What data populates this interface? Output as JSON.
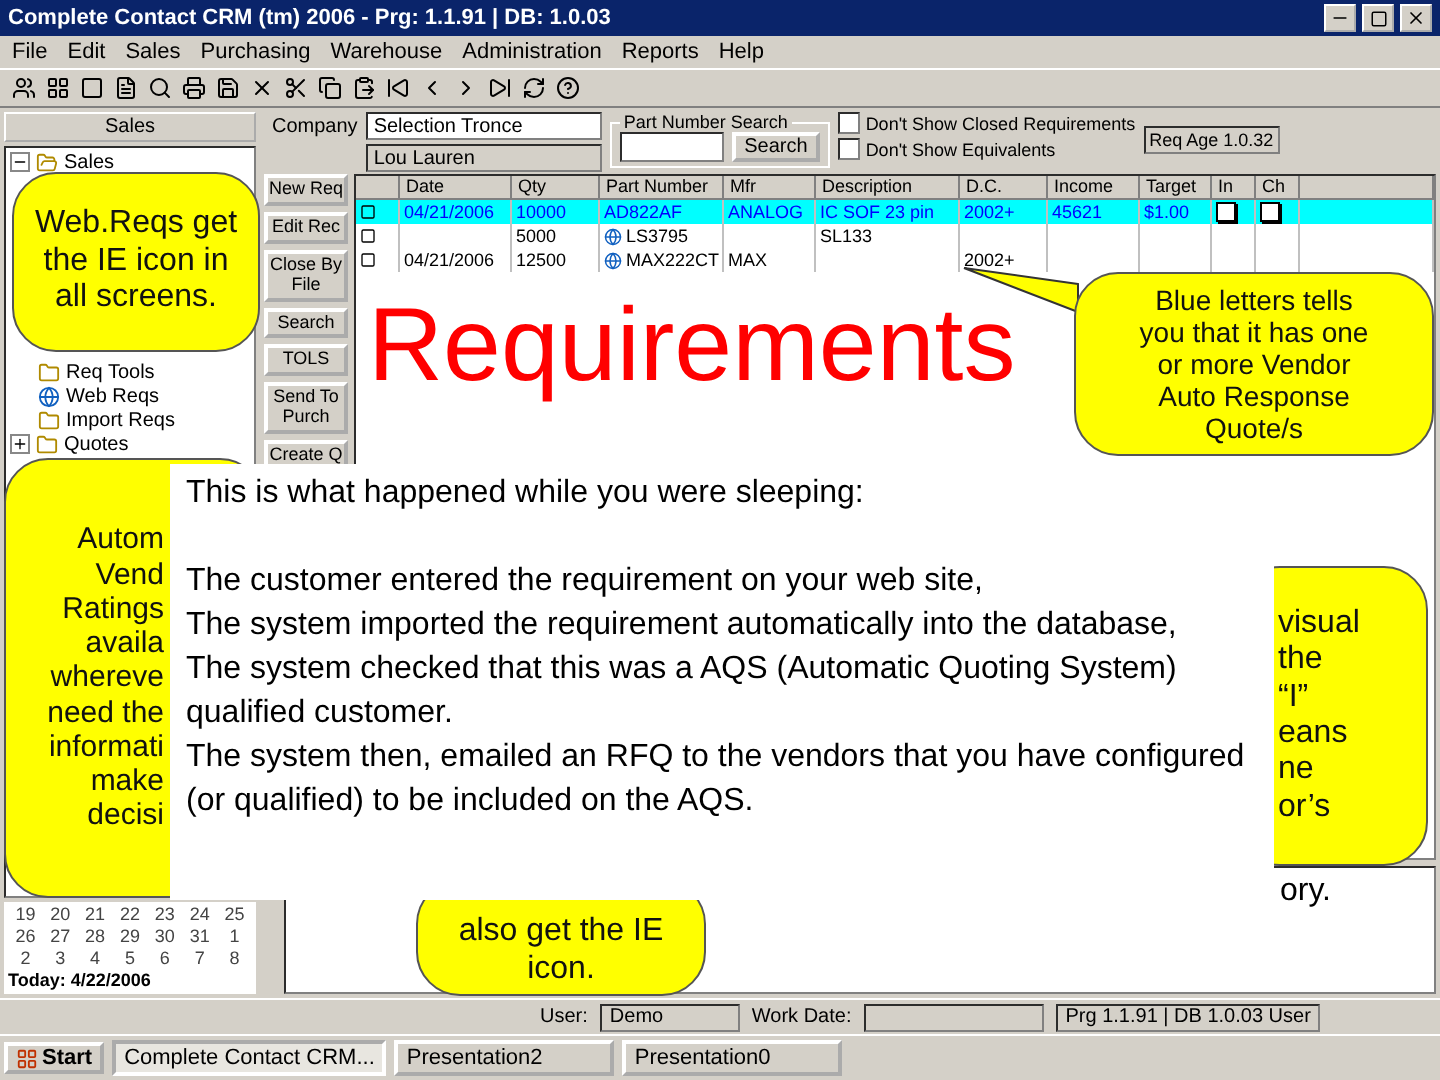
{
  "window": {
    "title": "Complete Contact CRM (tm) 2006 - Prg: 1.1.91 | DB: 1.0.03"
  },
  "menu": [
    "File",
    "Edit",
    "Sales",
    "Purchasing",
    "Warehouse",
    "Administration",
    "Reports",
    "Help"
  ],
  "sidebar": {
    "header": "Sales",
    "tree": [
      {
        "label": "Sales",
        "expanded": true,
        "children": [
          {
            "label": "Req Tools"
          },
          {
            "label": "Web Reqs",
            "kind": "web"
          },
          {
            "label": "Import Reqs"
          }
        ]
      },
      {
        "label": "Quotes",
        "expanded": false
      }
    ]
  },
  "calendar": {
    "weeks": [
      [
        "19",
        "20",
        "21",
        "22",
        "23",
        "24",
        "25"
      ],
      [
        "26",
        "27",
        "28",
        "29",
        "30",
        "31",
        "1"
      ],
      [
        "2",
        "3",
        "4",
        "5",
        "6",
        "7",
        "8"
      ]
    ],
    "today": "Today: 4/22/2006"
  },
  "filters": {
    "company_label": "Company",
    "company": "Selection Tronce",
    "contact": "Lou Lauren",
    "search_group": "Part Number Search",
    "search_button": "Search",
    "options": [
      {
        "label": "Don't Show Closed Requirements",
        "checked": false
      },
      {
        "label": "Don't Show Equivalents",
        "checked": false
      }
    ],
    "req_age": "Req Age 1.0.32"
  },
  "actions": [
    "New Req",
    "Edit Rec",
    "Close By File",
    "Search",
    "TOLS",
    "Send To Purch",
    "Create Q"
  ],
  "table": {
    "columns": [
      "Date",
      "Qty",
      "Part Number",
      "Mfr",
      "Description",
      "D.C.",
      "Income",
      "Target",
      "In",
      "Ch"
    ],
    "rows": [
      {
        "selected": true,
        "auto_quote": true,
        "web": false,
        "cells": [
          "04/21/2006",
          "10000",
          "AD822AF",
          "ANALOG",
          "IC SOF 23 pin",
          "2002+",
          "45621",
          "$1.00"
        ],
        "flags": [
          {
            "checked": false
          },
          {
            "checked": false
          }
        ]
      },
      {
        "selected": false,
        "auto_quote": false,
        "web": true,
        "cells": [
          "",
          "5000",
          "LS3795",
          "",
          "SL133",
          "",
          "",
          ""
        ]
      },
      {
        "selected": false,
        "auto_quote": false,
        "web": true,
        "cells": [
          "04/21/2006",
          "12500",
          "MAX222CT",
          "MAX",
          "",
          "2002+",
          "",
          ""
        ]
      }
    ]
  },
  "status_bar": {
    "user_label": "User:",
    "user": "Demo",
    "work_date_label": "Work Date:",
    "version": "Prg 1.1.91 | DB 1.0.03 User"
  },
  "taskbar": {
    "start": "Start",
    "tasks": [
      {
        "label": "Complete Contact CRM...",
        "selected": true
      },
      {
        "label": "Presentation2",
        "selected": false
      },
      {
        "label": "Presentation0",
        "selected": false
      }
    ]
  },
  "slide": {
    "heading": "Requirements",
    "callouts": [
      {
        "lines": [
          "Web.Reqs get",
          "the IE icon in",
          "all screens."
        ]
      },
      {
        "lines": [
          "Blue letters tells",
          "you that it has  one",
          "or more Vendor",
          "Auto Response",
          "Quote/s"
        ]
      },
      {
        "lines": [
          "Autom",
          "Vend",
          "Ratings",
          "availa",
          "whereve",
          "need the",
          "informati",
          "make",
          "decisi"
        ]
      },
      {
        "lines": [
          "visual",
          "the",
          "“I”",
          "eans",
          "ne",
          "or’s"
        ]
      },
      {
        "lines": [
          "also get the IE",
          "icon."
        ]
      }
    ],
    "fragment": "ory.",
    "note": {
      "title": "This is what happened while you were sleeping:",
      "lines": [
        "The customer entered the requirement on your web site,",
        "The system imported the requirement automatically into the database,",
        "The system checked that this was a AQS (Automatic Quoting System) qualified customer.",
        "The system then, emailed an RFQ to the vendors that you have configured (or qualified) to be included on the AQS."
      ]
    }
  }
}
